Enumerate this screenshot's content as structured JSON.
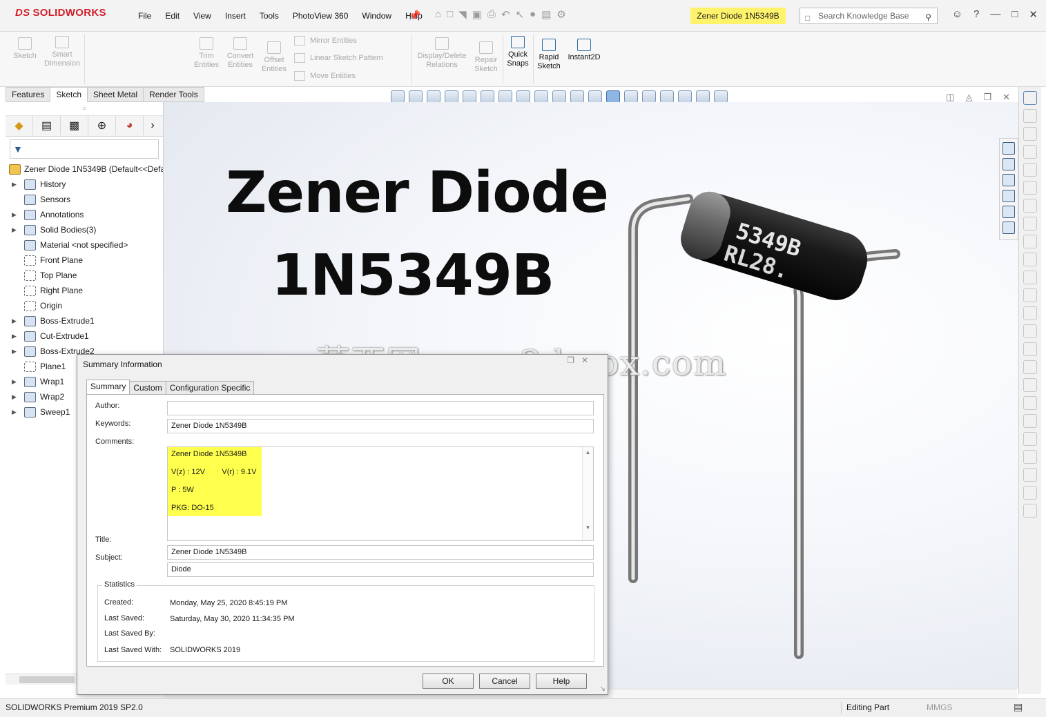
{
  "app": {
    "logo": "SOLIDWORKS",
    "logo_ds": "DS",
    "menu": [
      "File",
      "Edit",
      "View",
      "Insert",
      "Tools",
      "PhotoView 360",
      "Window",
      "Help"
    ],
    "document_title": "Zener Diode 1N5349B",
    "search_placeholder": "Search Knowledge Base"
  },
  "ribbon": {
    "sketch": "Sketch",
    "smart_dimension": "Smart Dimension",
    "trim_entities": "Trim Entities",
    "convert_entities": "Convert Entities",
    "offset_entities": "Offset Entities",
    "mirror_entities": "Mirror Entities",
    "linear_sketch_pattern": "Linear Sketch Pattern",
    "move_entities": "Move Entities",
    "display_delete_relations": "Display/Delete Relations",
    "repair_sketch": "Repair Sketch",
    "quick_snaps": "Quick Snaps",
    "rapid_sketch": "Rapid Sketch",
    "instant2d": "Instant2D"
  },
  "command_tabs": [
    "Features",
    "Sketch",
    "Sheet Metal",
    "Render Tools"
  ],
  "active_tab": "Sketch",
  "feature_tree": {
    "root": "Zener Diode 1N5349B  (Default<<Defa",
    "items": [
      {
        "label": "History",
        "expandable": true
      },
      {
        "label": "Sensors",
        "expandable": false
      },
      {
        "label": "Annotations",
        "expandable": true
      },
      {
        "label": "Solid Bodies(3)",
        "expandable": true
      },
      {
        "label": "Material <not specified>",
        "expandable": false
      },
      {
        "label": "Front Plane",
        "expandable": false
      },
      {
        "label": "Top Plane",
        "expandable": false
      },
      {
        "label": "Right Plane",
        "expandable": false
      },
      {
        "label": "Origin",
        "expandable": false
      },
      {
        "label": "Boss-Extrude1",
        "expandable": true
      },
      {
        "label": "Cut-Extrude1",
        "expandable": true
      },
      {
        "label": "Boss-Extrude2",
        "expandable": true
      },
      {
        "label": "Plane1",
        "expandable": false
      },
      {
        "label": "Wrap1",
        "expandable": true
      },
      {
        "label": "Wrap2",
        "expandable": true
      },
      {
        "label": "Sweep1",
        "expandable": true
      }
    ]
  },
  "viewport": {
    "heading_line1": "Zener Diode",
    "heading_line2": "1N5349B",
    "watermark": "莫西网www.3dmox.com",
    "part_marking_line1": "5349B",
    "part_marking_line2": "RL28."
  },
  "dialog": {
    "title": "Summary Information",
    "tabs": [
      "Summary",
      "Custom",
      "Configuration Specific"
    ],
    "active_tab": "Summary",
    "author_label": "Author:",
    "author_value": "",
    "keywords_label": "Keywords:",
    "keywords_value": "Zener Diode 1N5349B",
    "comments_label": "Comments:",
    "comments_lines": [
      "Zener Diode 1N5349B",
      "V(z) : 12V        V(r) : 9.1V",
      "P : 5W",
      "PKG: DO-15"
    ],
    "title_label": "Title:",
    "title_value": "Zener Diode 1N5349B",
    "subject_label": "Subject:",
    "subject_value": "Diode",
    "statistics_label": "Statistics",
    "created_label": "Created:",
    "created_value": "Monday, May 25, 2020 8:45:19 PM",
    "last_saved_label": "Last Saved:",
    "last_saved_value": "Saturday, May 30, 2020 11:34:35 PM",
    "last_saved_by_label": "Last Saved By:",
    "last_saved_by_value": "",
    "last_saved_with_label": "Last Saved With:",
    "last_saved_with_value": "SOLIDWORKS 2019",
    "ok": "OK",
    "cancel": "Cancel",
    "help": "Help"
  },
  "status_bar": {
    "product": "SOLIDWORKS Premium 2019 SP2.0",
    "mode": "Editing Part",
    "units": "MMGS"
  },
  "colors": {
    "highlight": "#ffff4d",
    "brand_red": "#d01f2a"
  }
}
